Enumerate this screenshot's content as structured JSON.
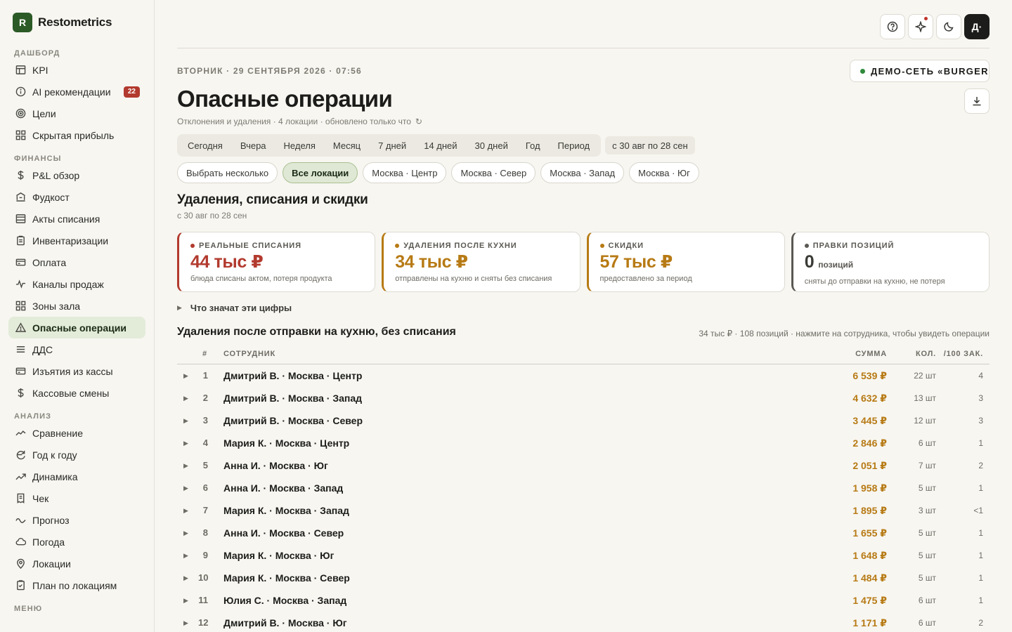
{
  "brand": {
    "logo_letter": "R",
    "name": "Restometrics"
  },
  "sidebar": {
    "sections": [
      {
        "title": "ДАШБОРД",
        "items": [
          {
            "label": "KPI",
            "icon": "table-icon"
          },
          {
            "label": "AI рекомендации",
            "icon": "info-icon",
            "badge": "22"
          },
          {
            "label": "Цели",
            "icon": "target-icon"
          },
          {
            "label": "Скрытая прибыль",
            "icon": "grid-icon"
          }
        ]
      },
      {
        "title": "ФИНАНСЫ",
        "items": [
          {
            "label": "P&L обзор",
            "icon": "dollar-icon"
          },
          {
            "label": "Фудкост",
            "icon": "bank-icon"
          },
          {
            "label": "Акты списания",
            "icon": "window-icon"
          },
          {
            "label": "Инвентаризации",
            "icon": "clipboard-icon"
          },
          {
            "label": "Оплата",
            "icon": "card-icon"
          },
          {
            "label": "Каналы продаж",
            "icon": "pulse-icon"
          },
          {
            "label": "Зоны зала",
            "icon": "grid-icon"
          },
          {
            "label": "Опасные операции",
            "icon": "warning-icon",
            "active": true
          },
          {
            "label": "ДДС",
            "icon": "list-icon"
          },
          {
            "label": "Изъятия из кассы",
            "icon": "card-icon"
          },
          {
            "label": "Кассовые смены",
            "icon": "dollar-icon"
          }
        ]
      },
      {
        "title": "АНАЛИЗ",
        "items": [
          {
            "label": "Сравнение",
            "icon": "compare-icon"
          },
          {
            "label": "Год к году",
            "icon": "cycle-icon"
          },
          {
            "label": "Динамика",
            "icon": "trend-icon"
          },
          {
            "label": "Чек",
            "icon": "receipt-icon"
          },
          {
            "label": "Прогноз",
            "icon": "wave-icon"
          },
          {
            "label": "Погода",
            "icon": "cloud-icon"
          },
          {
            "label": "Локации",
            "icon": "pin-icon"
          },
          {
            "label": "План по локациям",
            "icon": "checklist-icon"
          }
        ]
      },
      {
        "title": "МЕНЮ",
        "items": []
      }
    ]
  },
  "header": {
    "avatar": "Д·"
  },
  "page": {
    "dateline": "ВТОРНИК · 29 СЕНТЯБРЯ 2026 · 07:56",
    "network": "ДЕМО-СЕТЬ «BURGER HOUSE»",
    "title": "Опасные операции",
    "subtitle": "Отклонения и удаления · 4 локации · обновлено только что",
    "refresh": "↻"
  },
  "periods": [
    "Сегодня",
    "Вчера",
    "Неделя",
    "Месяц",
    "7 дней",
    "14 дней",
    "30 дней",
    "Год",
    "Период"
  ],
  "period_range": "с 30 авг по 28 сен",
  "locations": [
    {
      "label": "Выбрать несколько",
      "active": false
    },
    {
      "label": "Все локации",
      "active": true
    },
    {
      "label": "Москва · Центр",
      "active": false
    },
    {
      "label": "Москва · Север",
      "active": false
    },
    {
      "label": "Москва · Запад",
      "active": false
    },
    {
      "label": "Москва · Юг",
      "active": false
    }
  ],
  "section": {
    "title": "Удаления, списания и скидки",
    "sub": "с 30 авг по 28 сен"
  },
  "kpis": [
    {
      "label": "РЕАЛЬНЫЕ СПИСАНИЯ",
      "value": "44 тыс ₽",
      "unit": "",
      "desc": "блюда списаны актом, потеря продукта",
      "color": "#b23a2e"
    },
    {
      "label": "УДАЛЕНИЯ ПОСЛЕ КУХНИ",
      "value": "34 тыс ₽",
      "unit": "",
      "desc": "отправлены на кухню и сняты без списания",
      "color": "#b77a14"
    },
    {
      "label": "СКИДКИ",
      "value": "57 тыс ₽",
      "unit": "",
      "desc": "предоставлено за период",
      "color": "#b77a14"
    },
    {
      "label": "ПРАВКИ ПОЗИЦИЙ",
      "value": "0",
      "unit": "позиций",
      "desc": "сняты до отправки на кухню, не потеря",
      "color": "#5a5852"
    }
  ],
  "explain": "Что значат эти цифры",
  "table": {
    "title": "Удаления после отправки на кухню, без списания",
    "meta": "34 тыс ₽ · 108 позиций · нажмите на сотрудника, чтобы увидеть операции",
    "columns": {
      "num": "#",
      "name": "СОТРУДНИК",
      "sum": "СУММА",
      "qty": "КОЛ.",
      "per": "/100 ЗАК."
    },
    "rows": [
      {
        "num": "1",
        "name": "Дмитрий В. · Москва · Центр",
        "sum": "6 539 ₽",
        "qty": "22 шт",
        "per": "4"
      },
      {
        "num": "2",
        "name": "Дмитрий В. · Москва · Запад",
        "sum": "4 632 ₽",
        "qty": "13 шт",
        "per": "3"
      },
      {
        "num": "3",
        "name": "Дмитрий В. · Москва · Север",
        "sum": "3 445 ₽",
        "qty": "12 шт",
        "per": "3"
      },
      {
        "num": "4",
        "name": "Мария К. · Москва · Центр",
        "sum": "2 846 ₽",
        "qty": "6 шт",
        "per": "1"
      },
      {
        "num": "5",
        "name": "Анна И. · Москва · Юг",
        "sum": "2 051 ₽",
        "qty": "7 шт",
        "per": "2"
      },
      {
        "num": "6",
        "name": "Анна И. · Москва · Запад",
        "sum": "1 958 ₽",
        "qty": "5 шт",
        "per": "1"
      },
      {
        "num": "7",
        "name": "Мария К. · Москва · Запад",
        "sum": "1 895 ₽",
        "qty": "3 шт",
        "per": "<1"
      },
      {
        "num": "8",
        "name": "Анна И. · Москва · Север",
        "sum": "1 655 ₽",
        "qty": "5 шт",
        "per": "1"
      },
      {
        "num": "9",
        "name": "Мария К. · Москва · Юг",
        "sum": "1 648 ₽",
        "qty": "5 шт",
        "per": "1"
      },
      {
        "num": "10",
        "name": "Мария К. · Москва · Север",
        "sum": "1 484 ₽",
        "qty": "5 шт",
        "per": "1"
      },
      {
        "num": "11",
        "name": "Юлия С. · Москва · Запад",
        "sum": "1 475 ₽",
        "qty": "6 шт",
        "per": "1"
      },
      {
        "num": "12",
        "name": "Дмитрий В. · Москва · Юг",
        "sum": "1 171 ₽",
        "qty": "6 шт",
        "per": "2"
      }
    ]
  }
}
